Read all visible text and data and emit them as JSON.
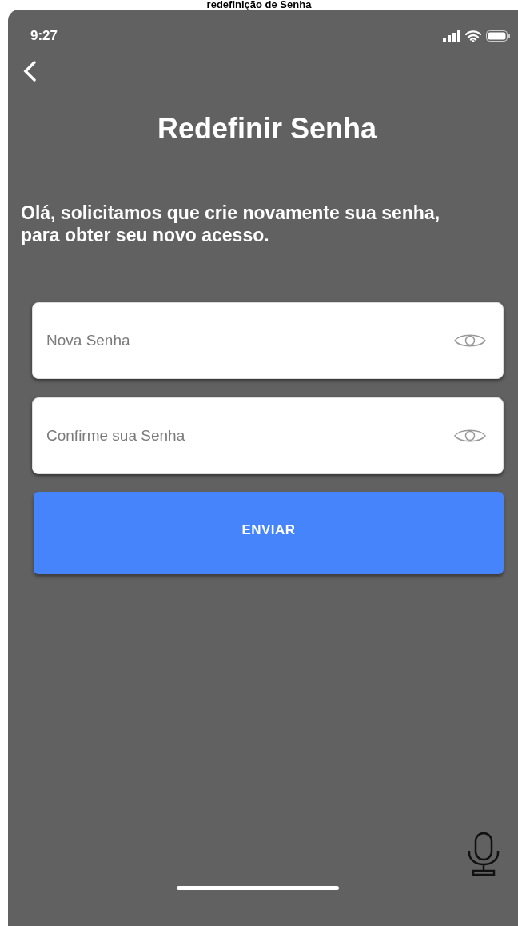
{
  "page_title": "redefinição de Senha",
  "status_bar": {
    "time": "9:27"
  },
  "title": "Redefinir Senha",
  "message": "Olá, solicitamos que crie novamente sua senha, para obter seu novo acesso.",
  "fields": [
    {
      "placeholder": "Nova Senha"
    },
    {
      "placeholder": "Confirme sua Senha"
    }
  ],
  "submit_button": "ENVIAR"
}
